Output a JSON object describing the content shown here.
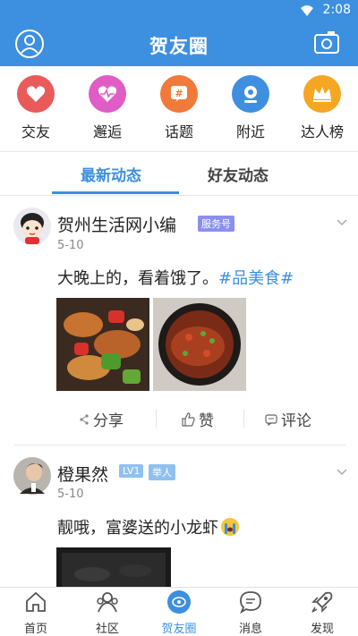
{
  "status_bar": {
    "time": "2:08"
  },
  "app_bar": {
    "title": "贺友圈"
  },
  "categories": [
    {
      "label": "交友",
      "icon": "heart-icon",
      "color": "#e95b5b"
    },
    {
      "label": "邂逅",
      "icon": "heartbeat-icon",
      "color": "#e05dc6"
    },
    {
      "label": "话题",
      "icon": "hashtag-icon",
      "color": "#f07a3a"
    },
    {
      "label": "附近",
      "icon": "location-icon",
      "color": "#3f8fe0"
    },
    {
      "label": "达人榜",
      "icon": "crown-icon",
      "color": "#f5a623"
    }
  ],
  "tabs": {
    "latest": "最新动态",
    "friends": "好友动态"
  },
  "posts": [
    {
      "author": "贺州生活网小编",
      "badge": "服务号",
      "date": "5-10",
      "text": "大晚上的，看着饿了。",
      "hashtag": "#品美食#",
      "actions": {
        "share": "分享",
        "like": "赞",
        "comment": "评论"
      }
    },
    {
      "author": "橙果然",
      "level": "LV1",
      "badge": "举人",
      "date": "5-10",
      "text": "靓哦，富婆送的小龙虾"
    }
  ],
  "bottom_nav": [
    {
      "label": "首页",
      "icon": "home-icon"
    },
    {
      "label": "社区",
      "icon": "community-icon"
    },
    {
      "label": "贺友圈",
      "icon": "circle-icon"
    },
    {
      "label": "消息",
      "icon": "message-icon"
    },
    {
      "label": "发现",
      "icon": "rocket-icon"
    }
  ],
  "colors": {
    "primary": "#3d8fe0",
    "badge_service": "#8a8ff0",
    "badge_level": "#8fc1ef"
  }
}
